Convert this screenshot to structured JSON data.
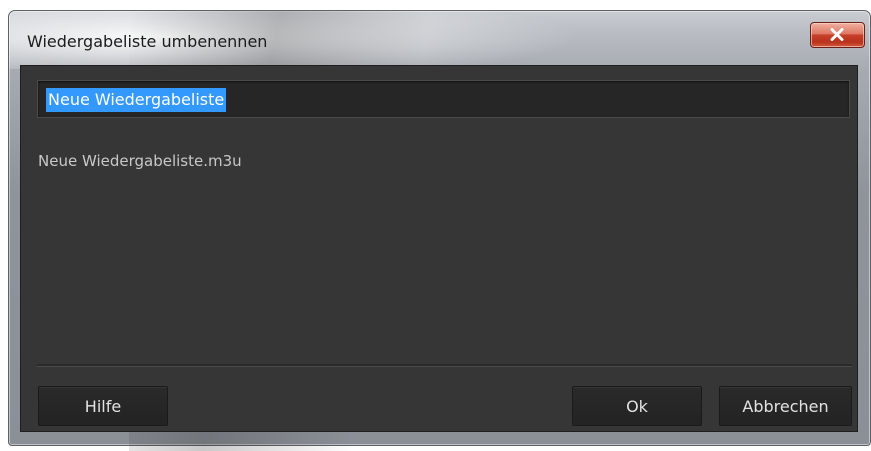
{
  "dialog": {
    "title": "Wiedergabeliste umbenennen",
    "close_icon": "close-x-icon"
  },
  "rename": {
    "input_value": "Neue Wiedergabeliste",
    "input_selected": true,
    "filename": "Neue Wiedergabeliste.m3u"
  },
  "buttons": {
    "help_label": "Hilfe",
    "ok_label": "Ok",
    "cancel_label": "Abbrechen"
  },
  "colors": {
    "panel_bg": "#363636",
    "input_bg": "#262626",
    "selection": "#3399ff",
    "close_button": "#c6412a"
  }
}
